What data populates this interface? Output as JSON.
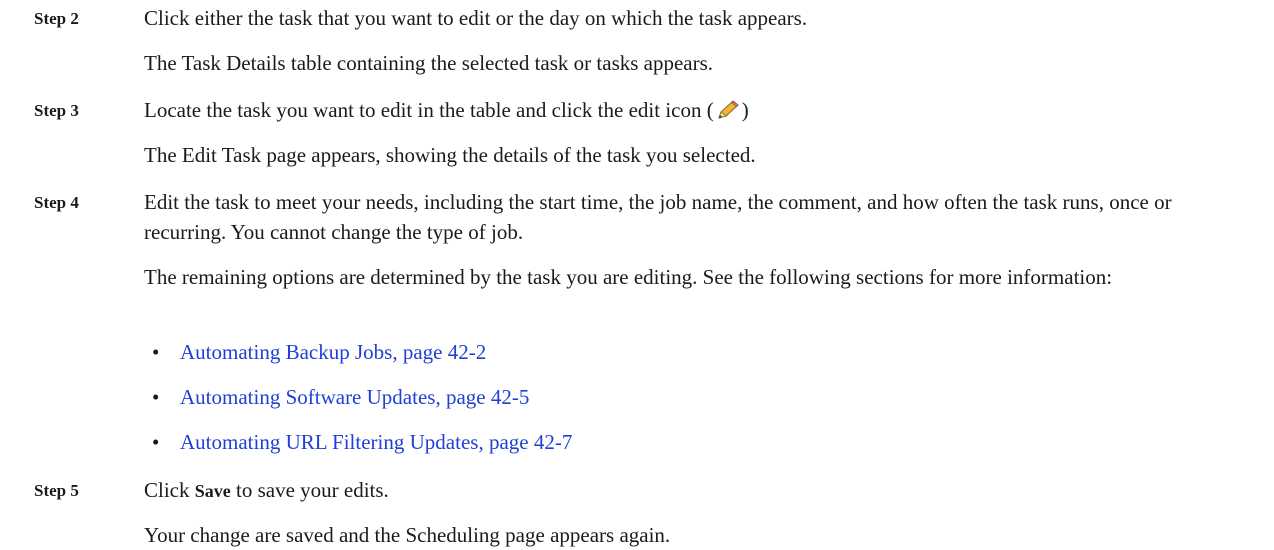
{
  "steps": [
    {
      "label": "Step 2",
      "paragraphs": [
        "Click either the task that you want to edit or the day on which the task appears.",
        "The Task Details table containing the selected task or tasks appears."
      ]
    },
    {
      "label": "Step 3",
      "paragraphs": [
        "Locate the task you want to edit in the table and click the edit icon (",
        ")",
        "The Edit Task page appears, showing the details of the task you selected."
      ],
      "icon": "pencil-edit-icon"
    },
    {
      "label": "Step 4",
      "paragraphs": [
        "Edit the task to meet your needs, including the start time, the job name, the comment, and how often the task runs, once or recurring. You cannot change the type of job.",
        "The remaining options are determined by the task you are editing. See the following sections for more information:"
      ],
      "links": [
        "Automating Backup Jobs, page 42-2",
        "Automating Software Updates, page 42-5",
        "Automating URL Filtering Updates, page 42-7"
      ],
      "bullet": "•"
    },
    {
      "label": "Step 5",
      "paragraphs": [
        "Click ",
        "Save",
        " to save your edits.",
        "Your change are saved and the Scheduling page appears again."
      ]
    }
  ],
  "colors": {
    "link": "#1f3fd6",
    "text": "#1a1a1a"
  }
}
